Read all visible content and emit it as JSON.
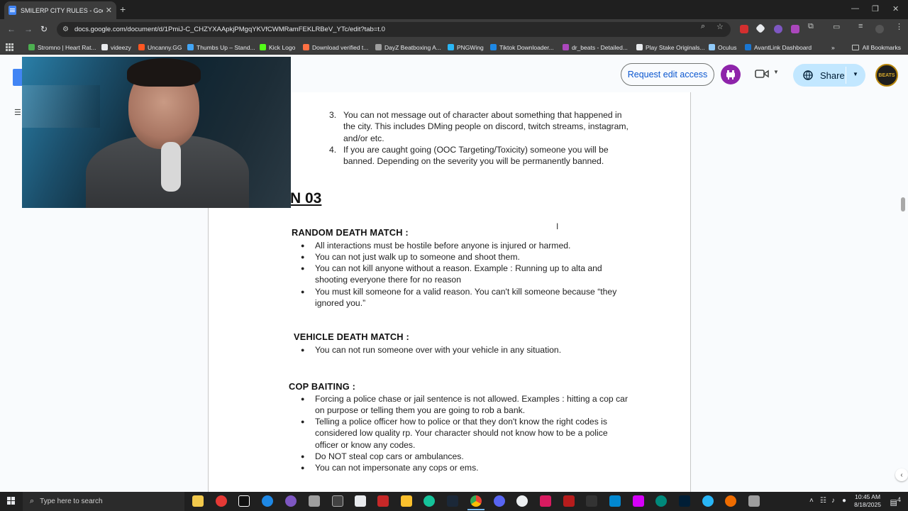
{
  "browser": {
    "tab_title": "SMILERP CITY RULES - Google",
    "url": "docs.google.com/document/d/1PmiJ-C_CHZYXAApkjPMgqYKVfCWMRamFEKLRBeV_YTc/edit?tab=t.0",
    "bookmarks": [
      {
        "label": "Stromno | Heart Rat...",
        "color": "#4caf50"
      },
      {
        "label": "videezy",
        "color": "#e8eaed"
      },
      {
        "label": "Uncanny.GG",
        "color": "#ff5722"
      },
      {
        "label": "Thumbs Up – Stand...",
        "color": "#42a5f5"
      },
      {
        "label": "Kick Logo",
        "color": "#53fc18"
      },
      {
        "label": "Download verified t...",
        "color": "#ff7043"
      },
      {
        "label": "DayZ Beatboxing A...",
        "color": "#9e9e9e"
      },
      {
        "label": "PNGWing",
        "color": "#29b6f6"
      },
      {
        "label": "Tiktok Downloader...",
        "color": "#1e88e5"
      },
      {
        "label": "dr_beats - Detailed...",
        "color": "#ab47bc"
      },
      {
        "label": "Play Stake Originals...",
        "color": "#e8eaed"
      },
      {
        "label": "Oculus",
        "color": "#90caf9"
      },
      {
        "label": "AvantLink Dashboard",
        "color": "#1976d2"
      }
    ],
    "all_bookmarks": "All Bookmarks"
  },
  "docs_header": {
    "request_edit": "Request edit access",
    "share": "Share",
    "avatar_text": "BEATS"
  },
  "document": {
    "numbered": [
      {
        "n": "3.",
        "lines": [
          "You can not message out of character about something that happened in",
          "the city. This includes DMing people on discord, twitch streams, instagram,",
          "and/or etc."
        ]
      },
      {
        "n": "4.",
        "lines": [
          "If you are caught going (OOC Targeting/Toxicity) someone you will be",
          "banned. Depending on the severity you will be permanently banned."
        ]
      }
    ],
    "section_title": "N 03",
    "sections": [
      {
        "heading": "RANDOM DEATH MATCH :",
        "bullets": [
          [
            "All interactions must be hostile before anyone is injured or harmed."
          ],
          [
            "You can not just walk up to someone and shoot them."
          ],
          [
            "You can not kill anyone without a reason. Example : Running up to alta and",
            "shooting everyone there for no reason"
          ],
          [
            "You must kill someone for a valid reason. You can't kill someone because “they",
            "ignored you.”"
          ]
        ]
      },
      {
        "heading": "VEHICLE DEATH MATCH :",
        "bullets": [
          [
            "You can not run someone over with your vehicle in any situation."
          ]
        ]
      },
      {
        "heading": "COP BAITING :",
        "bullets": [
          [
            "Forcing a police chase or jail sentence is not allowed. Examples : hitting a cop car",
            "on purpose or telling them you are going to rob a bank."
          ],
          [
            "Telling a police officer how to police or that they don't know the right codes is",
            "considered low quality rp. Your character should not know how to be a police",
            "officer or know any codes."
          ],
          [
            "Do NOT steal cop cars or ambulances."
          ],
          [
            "You can not impersonate any cops or ems."
          ]
        ]
      }
    ]
  },
  "taskbar": {
    "search_placeholder": "Type here to search",
    "time": "10:45 AM",
    "date": "8/18/2025",
    "notification_count": "4"
  }
}
